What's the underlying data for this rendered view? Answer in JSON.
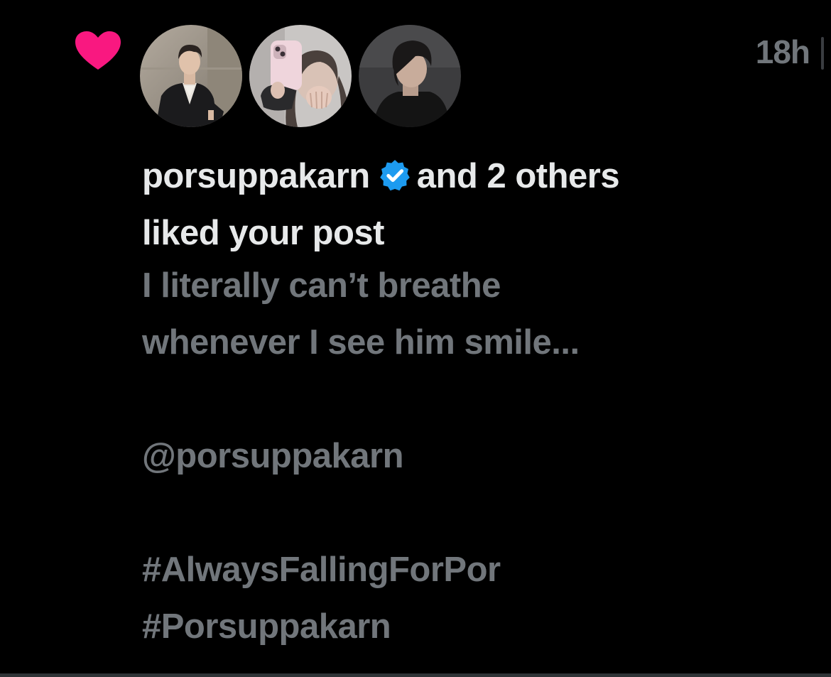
{
  "notification": {
    "type_icon": "heart-icon",
    "heart_color": "#f91880",
    "timestamp": "18h",
    "avatars": [
      {
        "name": "avatar-1"
      },
      {
        "name": "avatar-2"
      },
      {
        "name": "avatar-3"
      }
    ],
    "headline": {
      "username": "porsuppakarn",
      "verified_icon": "verified-badge-icon",
      "verified_color": "#1d9bf0",
      "others": "and 2 others",
      "action": "liked your post"
    },
    "post": {
      "line1": "I literally can’t breathe",
      "line2": "whenever I see him smile...",
      "mention": "@porsuppakarn",
      "hashtag1": "#AlwaysFallingForPor",
      "hashtag2": "#Porsuppakarn"
    }
  },
  "colors": {
    "background": "#000000",
    "primary_text": "#e7e9ea",
    "secondary_text": "#71767b"
  }
}
